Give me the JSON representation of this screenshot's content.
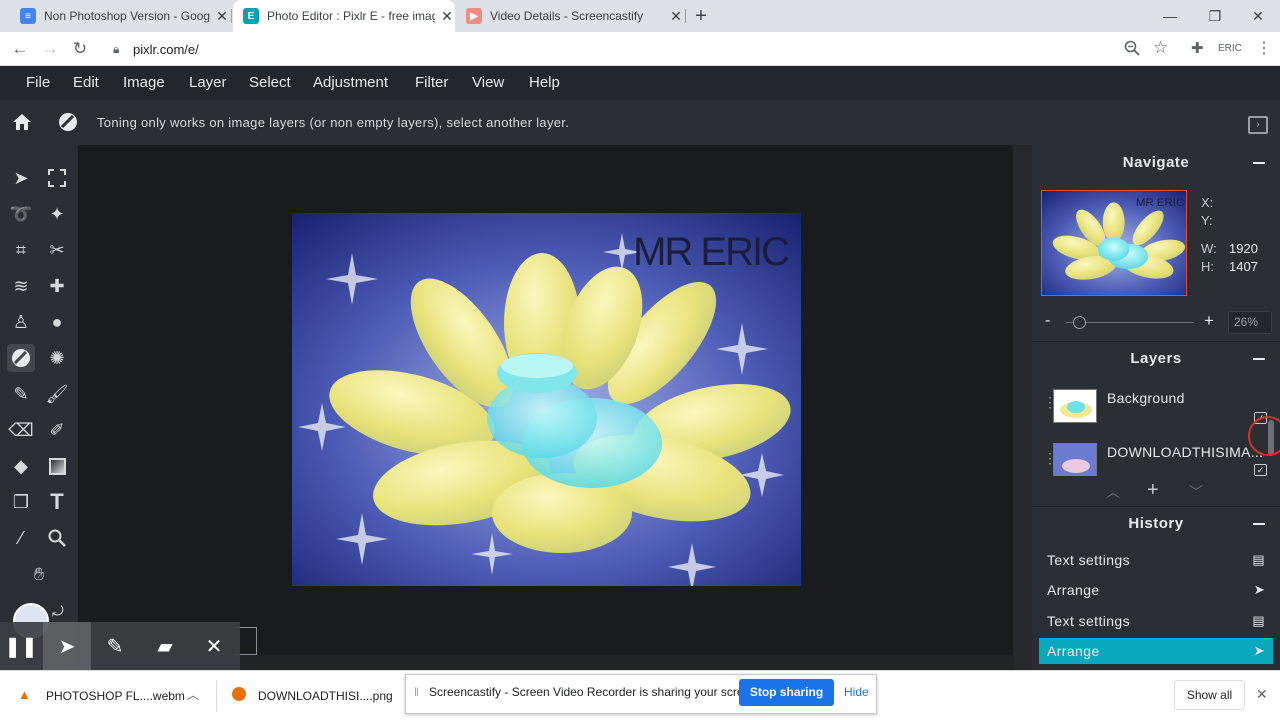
{
  "browser": {
    "tabs": [
      {
        "title": "Non Photoshop Version - Google",
        "favicon_color": "#4285f4"
      },
      {
        "title": "Photo Editor : Pixlr E - free image",
        "favicon_color": "#00a2b4"
      },
      {
        "title": "Video Details - Screencastify",
        "favicon_color": "#f06b6b"
      }
    ],
    "url": "pixlr.com/e/",
    "profile": "ERIC"
  },
  "menu": [
    "File",
    "Edit",
    "Image",
    "Layer",
    "Select",
    "Adjustment",
    "Filter",
    "View",
    "Help"
  ],
  "options_message": "Toning only works on image layers (or non empty layers), select another layer.",
  "canvas": {
    "watermark": "MR ERIC"
  },
  "navigate": {
    "title": "Navigate",
    "x_label": "X:",
    "y_label": "Y:",
    "w_label": "W:",
    "w_value": "1920",
    "h_label": "H:",
    "h_value": "1407",
    "minus": "-",
    "plus": "+",
    "zoom": "26%",
    "zoom_slider_fraction": 0.1,
    "thumb_watermark": "MR ERIC"
  },
  "layers": {
    "title": "Layers",
    "items": [
      {
        "name": "Background"
      },
      {
        "name": "DOWNLOADTHISIMA..."
      }
    ]
  },
  "history": {
    "title": "History",
    "items": [
      {
        "label": "Text settings",
        "icon": "document-icon"
      },
      {
        "label": "Arrange",
        "icon": "arrow-icon"
      },
      {
        "label": "Text settings",
        "icon": "document-icon"
      },
      {
        "label": "Arrange",
        "icon": "arrow-icon",
        "active": true
      }
    ],
    "active_color": "#0ba7bd"
  },
  "downloads": {
    "items": [
      {
        "name": "PHOTOSHOP FL....webm"
      },
      {
        "name": "DOWNLOADTHISI....png"
      }
    ],
    "show_all": "Show all"
  },
  "share_notice": {
    "text": "Screencastify - Screen Video Recorder is sharing your screen.",
    "stop": "Stop sharing",
    "hide": "Hide"
  }
}
